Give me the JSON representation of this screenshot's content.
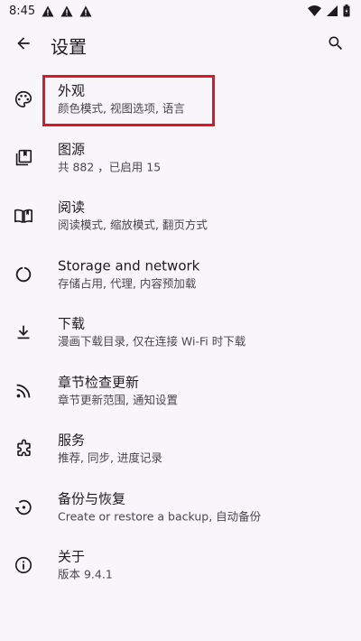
{
  "status_bar": {
    "time": "8:45",
    "icons": [
      "alert-icon",
      "alert-icon",
      "alert-icon",
      "wifi-icon",
      "signal-icon",
      "battery-icon"
    ]
  },
  "app_bar": {
    "title": "设置",
    "back_icon": "arrow-back-icon",
    "search_icon": "search-icon"
  },
  "settings": {
    "items": [
      {
        "title": "外观",
        "subtitle": "颜色模式, 视图选项, 语言",
        "icon": "palette-icon"
      },
      {
        "title": "图源",
        "subtitle": "共 882 ，已启用 15",
        "icon": "library-icon"
      },
      {
        "title": "阅读",
        "subtitle": "阅读模式, 缩放模式, 翻页方式",
        "icon": "book-icon"
      },
      {
        "title": "Storage and network",
        "subtitle": "存储占用, 代理, 内容预加载",
        "icon": "storage-ring-icon"
      },
      {
        "title": "下载",
        "subtitle": "漫画下载目录, 仅在连接 Wi-Fi 时下载",
        "icon": "download-icon"
      },
      {
        "title": "章节检查更新",
        "subtitle": "章节更新范围, 通知设置",
        "icon": "rss-icon"
      },
      {
        "title": "服务",
        "subtitle": "推荐, 同步, 进度记录",
        "icon": "puzzle-icon"
      },
      {
        "title": "备份与恢复",
        "subtitle": "Create or restore a backup, 自动备份",
        "icon": "restore-icon"
      },
      {
        "title": "关于",
        "subtitle": "版本 9.4.1",
        "icon": "info-icon"
      }
    ]
  },
  "annotation": {
    "highlighted_item": "外观",
    "color": "#e01526"
  }
}
